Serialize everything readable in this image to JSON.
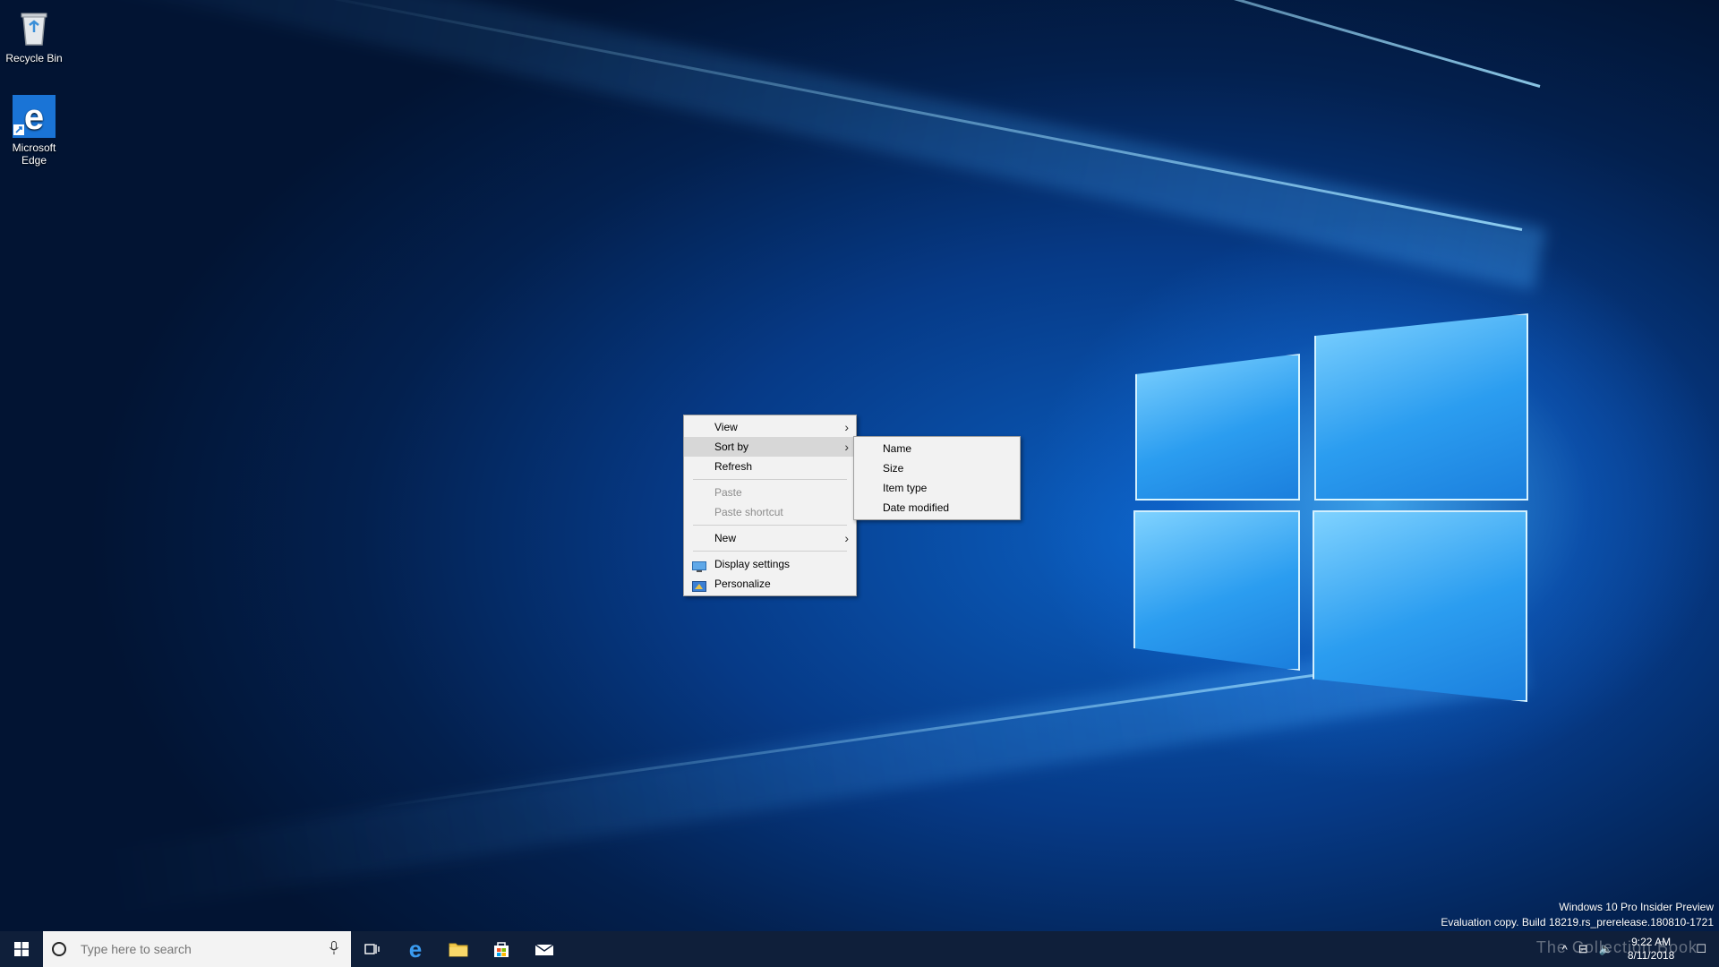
{
  "desktop_icons": [
    {
      "name": "recycle-bin",
      "label": "Recycle Bin",
      "icon": "recycle-bin-icon"
    },
    {
      "name": "microsoft-edge",
      "label": "Microsoft\nEdge",
      "icon": "edge-icon"
    }
  ],
  "context_menu": {
    "items": {
      "view": "View",
      "sort_by": "Sort by",
      "refresh": "Refresh",
      "paste": "Paste",
      "paste_shortcut": "Paste shortcut",
      "new": "New",
      "display_settings": "Display settings",
      "personalize": "Personalize"
    },
    "submenu_sort_by": [
      "Name",
      "Size",
      "Item type",
      "Date modified"
    ]
  },
  "taskbar": {
    "search_placeholder": "Type here to search",
    "clock_time": "9:22 AM",
    "clock_date": "8/11/2018"
  },
  "watermark": {
    "line1": "Windows 10 Pro Insider Preview",
    "line2": "Evaluation copy. Build 18219.rs_prerelease.180810-1721"
  },
  "overlay_brand": "The Collection Book",
  "colors": {
    "taskbar": "#0f1f3a",
    "menu_bg": "#f2f2f2",
    "menu_highlight": "#d7d7d7"
  }
}
